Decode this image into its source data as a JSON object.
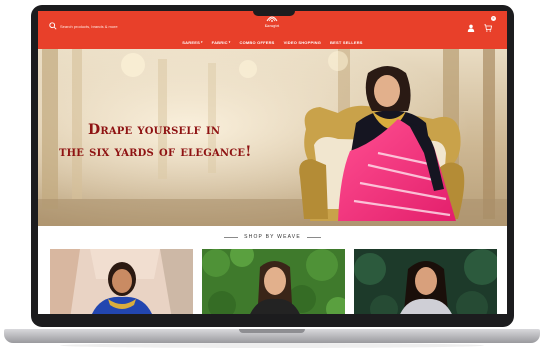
{
  "header": {
    "search_placeholder": "Search products, brands & more",
    "brand_name": "Karagiri",
    "cart_count": "0"
  },
  "nav": {
    "items": [
      {
        "label": "SAREES",
        "caret": "▾"
      },
      {
        "label": "FABRIC",
        "caret": "▾"
      },
      {
        "label": "COMBO OFFERS",
        "caret": ""
      },
      {
        "label": "VIDEO SHOPPING",
        "caret": ""
      },
      {
        "label": "BEST SELLERS",
        "caret": ""
      }
    ]
  },
  "hero": {
    "line1": "Drape yourself in",
    "line2": "the six yards of elegance!",
    "text_color": "#8e1212"
  },
  "weave": {
    "heading": "SHOP BY WEAVE"
  },
  "colors": {
    "brand": "#e8402a",
    "laptop_bezel": "#1c1c1e"
  },
  "icons": {
    "search": "search-icon",
    "user": "user-icon",
    "cart": "cart-icon",
    "logo": "brand-logo-icon"
  }
}
